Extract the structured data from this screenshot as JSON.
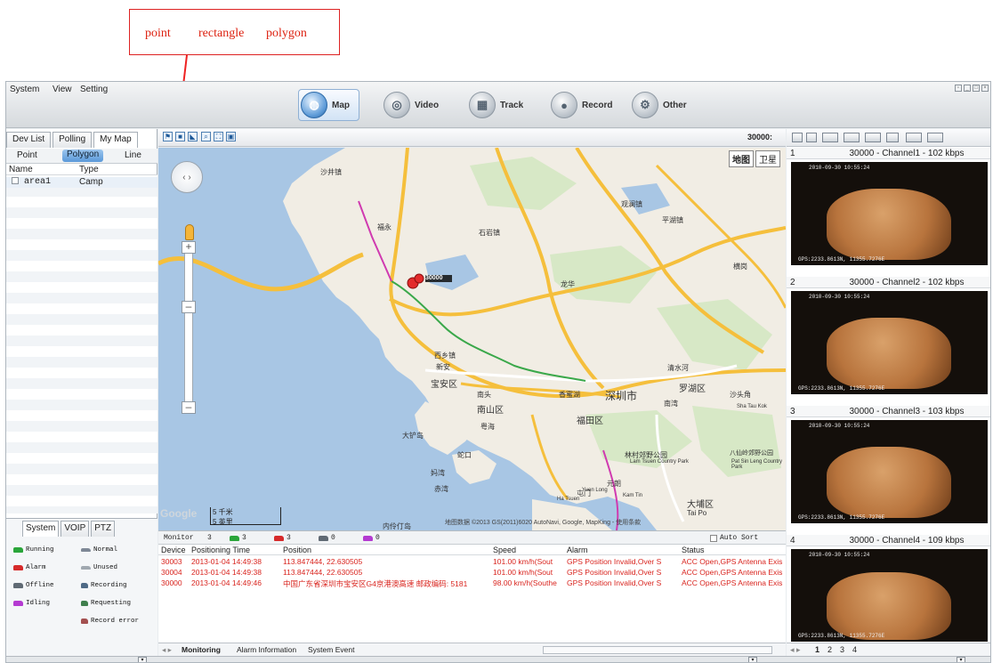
{
  "annotation": {
    "words": [
      "point",
      "rectangle",
      "polygon"
    ]
  },
  "menu": [
    "System",
    "View",
    "Setting"
  ],
  "modules": [
    {
      "label": "Map",
      "icon": "globe-icon"
    },
    {
      "label": "Video",
      "icon": "camera-icon"
    },
    {
      "label": "Track",
      "icon": "track-icon"
    },
    {
      "label": "Record",
      "icon": "record-icon"
    },
    {
      "label": "Other",
      "icon": "gear-icon"
    }
  ],
  "left_tabs": [
    "Dev List",
    "Polling",
    "My Map"
  ],
  "sub_tabs": [
    "Point",
    "Polygon",
    "Line"
  ],
  "area_table": {
    "headers": [
      "Name",
      "Type"
    ],
    "rows": [
      {
        "name": "area1",
        "type": "Camp"
      }
    ]
  },
  "lower_tabs": [
    "System",
    "VOIP",
    "PTZ"
  ],
  "legend": [
    {
      "label": "Running",
      "color": "#2aa53a"
    },
    {
      "label": "Normal",
      "color": "#7e8896"
    },
    {
      "label": "Alarm",
      "color": "#d62a2a"
    },
    {
      "label": "Unused",
      "color": "#a0a8b0"
    },
    {
      "label": "Offline",
      "color": "#606a74"
    },
    {
      "label": "Recording",
      "color": "#4f6a86"
    },
    {
      "label": "Idling",
      "color": "#b43ad1"
    },
    {
      "label": "Requesting",
      "color": "#3f7f4d"
    },
    {
      "label": "Record error",
      "color": "#a35050"
    }
  ],
  "map_toolbar": {
    "device_label": "30000:"
  },
  "map": {
    "map_btn": "地图",
    "sat_btn": "卫星",
    "scale_top": "5 千米",
    "scale_bottom": "5 英里",
    "copyright": "地图数据 ©2013 GS(2011)6020 AutoNavi, Google, MapKing - 使用条款",
    "logo": "Google",
    "marker_label": "30000",
    "places": [
      "沙井镇",
      "福永",
      "西乡镇",
      "新安",
      "宝安区",
      "南头",
      "南山区",
      "深圳市",
      "罗湖区",
      "福田区",
      "龙华",
      "石岩镇",
      "观澜镇",
      "平湖镇",
      "横岗",
      "蛇口",
      "妈湾",
      "赤湾",
      "元朗",
      "屯门",
      "大埔区",
      "沙头角",
      "内伶仃岛",
      "大铲岛",
      "香蜜湖",
      "清水河",
      "南湾",
      "粤海",
      "林村郊野公园",
      "Lam Tsuen Country Park",
      "Tai Po",
      "Yuen Long",
      "Ha Tsuen",
      "Kam Tin",
      "Sha Tau Kok",
      "八仙岭郊野公园",
      "Pat Sin Leng Country Park"
    ]
  },
  "monitor_head": {
    "label": "Monitor",
    "total": "3",
    "running": "3",
    "alarm": "3",
    "offline": "0",
    "idling": "0",
    "auto_sort": "Auto Sort"
  },
  "monitor_table": {
    "headers": [
      "Device",
      "Positioning Time",
      "Position",
      "Speed",
      "Alarm",
      "Status"
    ],
    "rows": [
      {
        "device": "30003",
        "time": "2013-01-04 14:49:38",
        "position": "113.847444, 22.630505",
        "speed": "101.00 km/h(Sout",
        "alarm": "GPS Position Invalid,Over S",
        "status": "ACC Open,GPS Antenna Exis"
      },
      {
        "device": "30004",
        "time": "2013-01-04 14:49:38",
        "position": "113.847444, 22.630505",
        "speed": "101.00 km/h(Sout",
        "alarm": "GPS Position Invalid,Over S",
        "status": "ACC Open,GPS Antenna Exis"
      },
      {
        "device": "30000",
        "time": "2013-01-04 14:49:46",
        "position": "中国广东省深圳市宝安区G4京港澳高速 邮政编码: 5181",
        "speed": "98.00 km/h(Southe",
        "alarm": "GPS Position Invalid,Over S",
        "status": "ACC Open,GPS Antenna Exis"
      }
    ]
  },
  "monitor_tabs": [
    "Monitoring",
    "Alarm Information",
    "System Event"
  ],
  "channels": [
    {
      "num": "1",
      "title": "30000 - Channel1 - 102 kbps",
      "osd_time": "2010-09-30 10:55:24",
      "osd_gps": "GPS:2233.8613N, 11355.7276E"
    },
    {
      "num": "2",
      "title": "30000 - Channel2 - 102 kbps",
      "osd_time": "2010-09-30 10:55:24",
      "osd_gps": "GPS:2233.8613N, 11355.7276E"
    },
    {
      "num": "3",
      "title": "30000 - Channel3 - 103 kbps",
      "osd_time": "2010-09-30 10:55:24",
      "osd_gps": "GPS:2233.8613N, 11355.7276E"
    },
    {
      "num": "4",
      "title": "30000 - Channel4 - 109 kbps",
      "osd_time": "2010-09-30 10:55:24",
      "osd_gps": "GPS:2233.8613N, 11355.7276E"
    }
  ],
  "video_pages": [
    "1",
    "2",
    "3",
    "4"
  ]
}
